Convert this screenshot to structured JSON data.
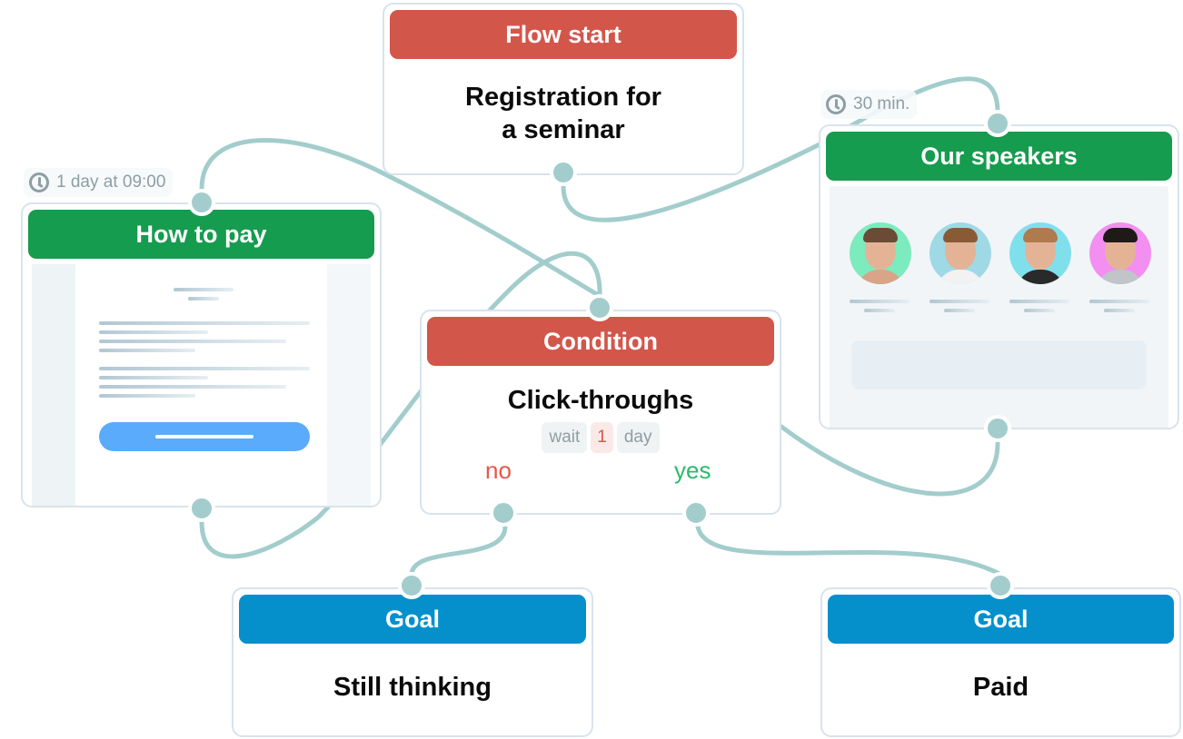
{
  "colors": {
    "start_header": "#d3564b",
    "email_header": "#159c4e",
    "goal_header": "#0590cc",
    "connector": "#a2cdcc",
    "branch_no": "#e8574a",
    "branch_yes": "#2cbb6b"
  },
  "nodes": {
    "flow_start": {
      "type": "Flow start",
      "title_line1": "Registration for",
      "title_line2": "a seminar"
    },
    "how_to_pay": {
      "type": "How to pay",
      "delay_icon": "clock-icon",
      "delay": "1 day at 09:00"
    },
    "our_speakers": {
      "type": "Our speakers",
      "delay_icon": "clock-icon",
      "delay": "30 min.",
      "speakers": [
        {
          "name": "speaker-1",
          "bg": "#7cebbd"
        },
        {
          "name": "speaker-2",
          "bg": "#9fd9e6"
        },
        {
          "name": "speaker-3",
          "bg": "#7fe0ec"
        },
        {
          "name": "speaker-4",
          "bg": "#f28ff0"
        }
      ]
    },
    "condition": {
      "type": "Condition",
      "title": "Click-throughs",
      "wait_label": "wait",
      "wait_value": "1",
      "wait_unit": "day",
      "branch_no": "no",
      "branch_yes": "yes"
    },
    "goal_still_thinking": {
      "type": "Goal",
      "title": "Still thinking"
    },
    "goal_paid": {
      "type": "Goal",
      "title": "Paid"
    }
  }
}
